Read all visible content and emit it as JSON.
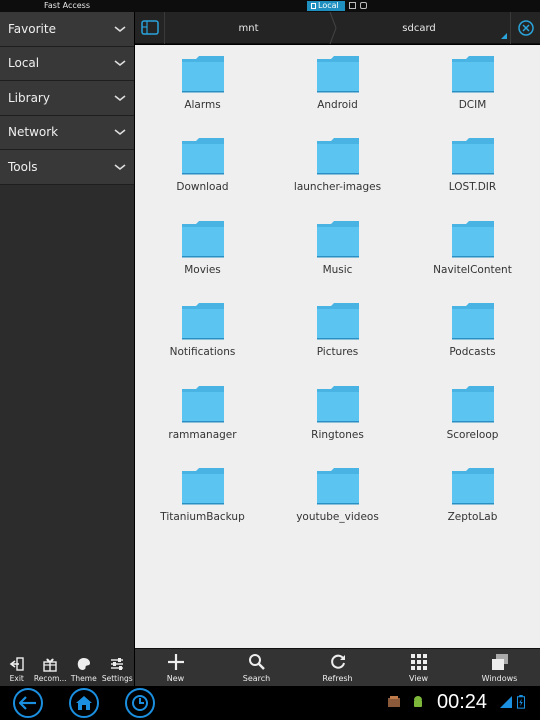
{
  "top_strip": {
    "fast_access": "Fast Access",
    "active_tab": "Local"
  },
  "sidebar": {
    "items": [
      {
        "label": "Favorite"
      },
      {
        "label": "Local"
      },
      {
        "label": "Library"
      },
      {
        "label": "Network"
      },
      {
        "label": "Tools"
      }
    ]
  },
  "path_bar": {
    "segments": [
      "mnt",
      "sdcard"
    ]
  },
  "folders": [
    "Alarms",
    "Android",
    "DCIM",
    "Download",
    "launcher-images",
    "LOST.DIR",
    "Movies",
    "Music",
    "NavitelContent",
    "Notifications",
    "Pictures",
    "Podcasts",
    "rammanager",
    "Ringtones",
    "Scoreloop",
    "TitaniumBackup",
    "youtube_videos",
    "ZeptoLab"
  ],
  "left_toolbar": {
    "exit": "Exit",
    "recommend": "Recom...",
    "theme": "Theme",
    "settings": "Settings"
  },
  "right_toolbar": {
    "new": "New",
    "search": "Search",
    "refresh": "Refresh",
    "view": "View",
    "windows": "Windows"
  },
  "system_bar": {
    "clock": "00:24"
  },
  "colors": {
    "accent": "#2aa4dc",
    "folder": "#5bc4f1",
    "folder_tab": "#49b4e4"
  }
}
